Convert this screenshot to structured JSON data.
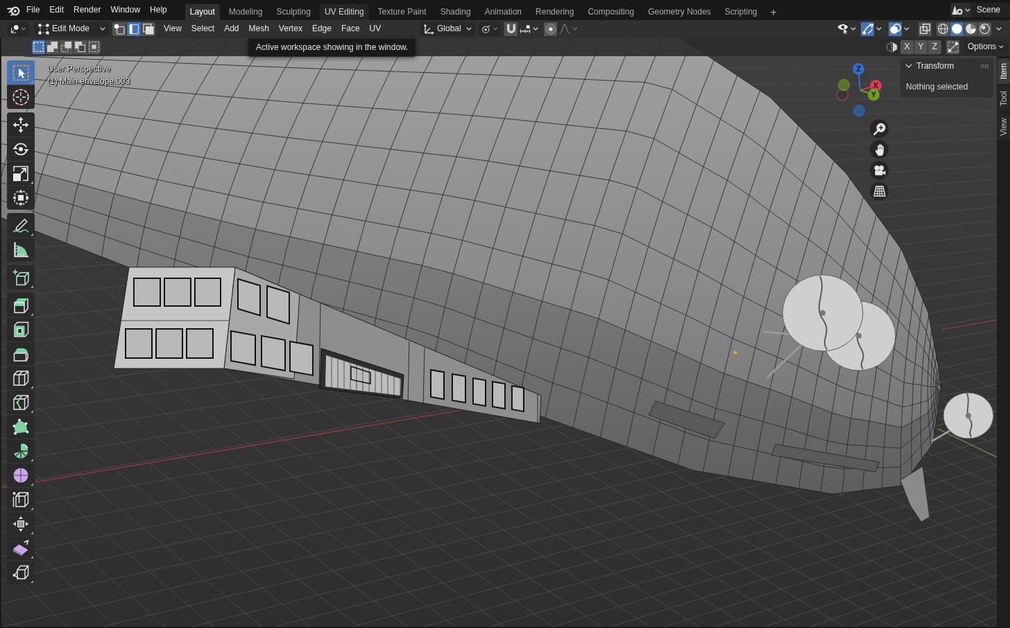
{
  "topbar": {
    "menus": [
      "File",
      "Edit",
      "Render",
      "Window",
      "Help"
    ],
    "workspaces": [
      {
        "label": "Layout",
        "selected": true,
        "hovered": false
      },
      {
        "label": "Modeling",
        "selected": false,
        "hovered": false
      },
      {
        "label": "Sculpting",
        "selected": false,
        "hovered": false
      },
      {
        "label": "UV Editing",
        "selected": false,
        "hovered": true
      },
      {
        "label": "Texture Paint",
        "selected": false,
        "hovered": false
      },
      {
        "label": "Shading",
        "selected": false,
        "hovered": false
      },
      {
        "label": "Animation",
        "selected": false,
        "hovered": false
      },
      {
        "label": "Rendering",
        "selected": false,
        "hovered": false
      },
      {
        "label": "Compositing",
        "selected": false,
        "hovered": false
      },
      {
        "label": "Geometry Nodes",
        "selected": false,
        "hovered": false
      },
      {
        "label": "Scripting",
        "selected": false,
        "hovered": false
      }
    ],
    "add_workspace": "+",
    "scene": "Scene"
  },
  "header": {
    "mode": "Edit Mode",
    "select_modes": [
      {
        "kind": "vertex",
        "selected": false
      },
      {
        "kind": "edge",
        "selected": true
      },
      {
        "kind": "face",
        "selected": false
      }
    ],
    "menus": [
      "View",
      "Select",
      "Add",
      "Mesh",
      "Vertex",
      "Edge",
      "Face",
      "UV"
    ],
    "orientation": "Global",
    "snap": {
      "on": false
    },
    "proportional": {
      "on": false
    },
    "gizmos": {
      "on": true
    },
    "overlays": {
      "on": true
    },
    "xray": {
      "on": false
    },
    "shading": [
      {
        "kind": "wireframe",
        "selected": false
      },
      {
        "kind": "solid",
        "selected": true
      },
      {
        "kind": "material",
        "selected": false
      },
      {
        "kind": "rendered",
        "selected": false
      }
    ]
  },
  "tooltip": "Active workspace showing in the window.",
  "tool_settings": {
    "select_modes": [
      {
        "kind": "new",
        "selected": true
      },
      {
        "kind": "extend",
        "selected": false
      },
      {
        "kind": "subtract",
        "selected": false
      },
      {
        "kind": "invert",
        "selected": false
      },
      {
        "kind": "intersect",
        "selected": false
      }
    ],
    "mirror_axes": [
      {
        "label": "X",
        "on": false
      },
      {
        "label": "Y",
        "on": false
      },
      {
        "label": "Z",
        "on": false
      }
    ],
    "auto_merge": {
      "on": false
    },
    "options": "Options"
  },
  "toolbar": {
    "groups": [
      [
        {
          "kind": "select_box",
          "selected": true,
          "variants": true
        },
        {
          "kind": "cursor",
          "selected": false,
          "variants": false
        }
      ],
      [
        {
          "kind": "move",
          "selected": false,
          "variants": false
        },
        {
          "kind": "rotate",
          "selected": false,
          "variants": false
        },
        {
          "kind": "scale",
          "selected": false,
          "variants": true
        },
        {
          "kind": "transform",
          "selected": false,
          "variants": false
        }
      ],
      [
        {
          "kind": "annotate",
          "selected": false,
          "variants": true
        },
        {
          "kind": "measure",
          "selected": false,
          "variants": false
        }
      ],
      [
        {
          "kind": "add_cube",
          "selected": false,
          "variants": true
        }
      ],
      [
        {
          "kind": "extrude",
          "selected": false,
          "variants": true
        },
        {
          "kind": "inset",
          "selected": false,
          "variants": false
        },
        {
          "kind": "bevel",
          "selected": false,
          "variants": false
        },
        {
          "kind": "loop_cut",
          "selected": false,
          "variants": true
        },
        {
          "kind": "knife",
          "selected": false,
          "variants": true
        },
        {
          "kind": "poly_build",
          "selected": false,
          "variants": false
        },
        {
          "kind": "spin",
          "selected": false,
          "variants": true
        },
        {
          "kind": "smooth",
          "selected": false,
          "variants": true
        },
        {
          "kind": "edge_slide",
          "selected": false,
          "variants": true
        },
        {
          "kind": "shrink_fatten",
          "selected": false,
          "variants": true
        },
        {
          "kind": "shear",
          "selected": false,
          "variants": true
        },
        {
          "kind": "rip",
          "selected": false,
          "variants": true
        }
      ]
    ]
  },
  "viewport": {
    "view_name": "User Perspective",
    "object_label": "(1) Main envelope.003"
  },
  "nav_gizmo": {
    "axes": [
      {
        "label": "Z",
        "color": "#2f6ecf"
      },
      {
        "label": "X",
        "color": "#dd3c55"
      },
      {
        "label": "Y",
        "color": "#6f9f22"
      }
    ]
  },
  "sidebar": {
    "panels": [
      {
        "title": "Transform",
        "expanded": true,
        "message": "Nothing selected"
      }
    ],
    "tabs": [
      {
        "label": "Item",
        "selected": true
      },
      {
        "label": "Tool",
        "selected": false
      },
      {
        "label": "View",
        "selected": false
      }
    ]
  }
}
